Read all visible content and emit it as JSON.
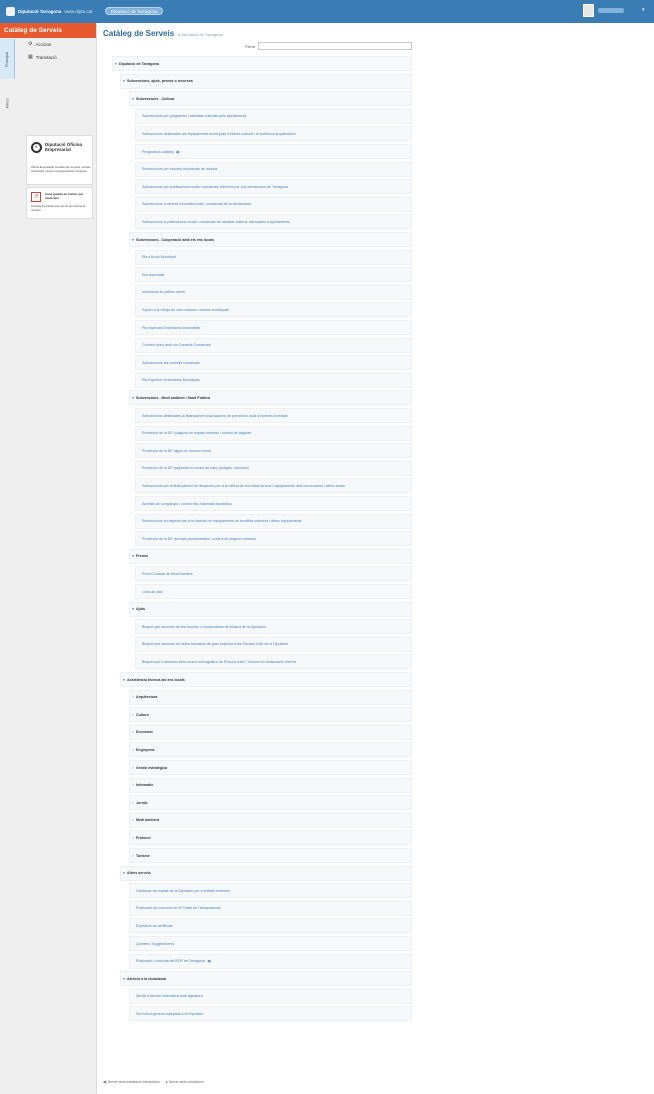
{
  "topbar": {
    "brand": "Diputació Tarragona",
    "brand_url": "www.dipta.cat",
    "pill": "Diputació de Tarragona",
    "user_caret": "▾"
  },
  "sidebar": {
    "title": "Catàleg de Serveis",
    "tabs": [
      "Principal",
      "Altres"
    ],
    "items": [
      {
        "icon": "⚙",
        "label": "Accions"
      },
      {
        "icon": "▦",
        "label": "Tramitació"
      }
    ],
    "ad1": {
      "name": "Diputació Oficina Empresarial",
      "desc": "Oficina Empresarial: Accedeix als recursos i serveis d'orientació i suport a l'emprenedoria i l'empresa"
    },
    "ad2": {
      "name": "Zona guiada de tràmits per municipis",
      "desc": "Consulta els tràmits que pots fer per Internet al municipi"
    }
  },
  "main": {
    "title": "Catàleg de Serveis",
    "subtitle": "a Diputació de Tarragona",
    "filter_label": "Filtrar",
    "filter_value": "",
    "rows": [
      {
        "level": 0,
        "kind": "cat",
        "arrow": "▾",
        "label": "Diputació de Tarragona"
      },
      {
        "level": 1,
        "kind": "cat",
        "arrow": "▾",
        "label": "Subvencions, ajuts, premis o recursos"
      },
      {
        "level": 2,
        "kind": "cat",
        "arrow": "▾",
        "label": "Subvencions - Cultura"
      },
      {
        "level": 3,
        "kind": "leaf",
        "label": "Subvencions per programes i activitats culturals pels ajuntaments"
      },
      {
        "level": 3,
        "kind": "leaf",
        "label": "Subvencions destinades als equipaments municipals d'interès cultural i al patrimoni arquitectònic"
      },
      {
        "level": 3,
        "kind": "leaf",
        "label": "Programa e-catàleg",
        "badge": "◀)"
      },
      {
        "level": 3,
        "kind": "leaf",
        "label": "Subvencions per escoles municipals de música"
      },
      {
        "level": 3,
        "kind": "leaf",
        "label": "Subvencions per publicacions locals i comarcals d'interès per a la demarcació de Tarragona"
      },
      {
        "level": 3,
        "kind": "leaf",
        "label": "Subvencions a centres d'estudis locals i comarcals de la demarcació"
      },
      {
        "level": 3,
        "kind": "leaf",
        "label": "Subvencions a publicacions locals i comarcals de caràcter cultural, adreçades a ajuntaments"
      },
      {
        "level": 2,
        "kind": "cat",
        "arrow": "▾",
        "label": "Subvencions - Cooperació amb els ens locals"
      },
      {
        "level": 3,
        "kind": "leaf",
        "label": "Pla d'Acció Municipal"
      },
      {
        "level": 3,
        "kind": "leaf",
        "label": "Ens Associats"
      },
      {
        "level": 3,
        "kind": "leaf",
        "label": "Inversions de petites obres"
      },
      {
        "level": 3,
        "kind": "leaf",
        "label": "Suport a la neteja de vies urbanes i camins municipals"
      },
      {
        "level": 3,
        "kind": "leaf",
        "label": "Pla especial d'inversions sostenibles"
      },
      {
        "level": 3,
        "kind": "leaf",
        "label": "Conveni marc amb els Consells Comarcals"
      },
      {
        "level": 3,
        "kind": "leaf",
        "label": "Subvencions als consells comarcals"
      },
      {
        "level": 3,
        "kind": "leaf",
        "label": "Pla Especial d'Inversions Municipals"
      },
      {
        "level": 2,
        "kind": "cat",
        "arrow": "▾",
        "label": "Subvencions - Medi ambient i Salut Pública"
      },
      {
        "level": 3,
        "kind": "leaf",
        "label": "Subvencions destinades al finançament d'actuacions de prevenció local d'incendis forestals"
      },
      {
        "level": 3,
        "kind": "leaf",
        "label": "Prevenció de la DP i plagues en espais forestals i control de plagues"
      },
      {
        "level": 3,
        "kind": "leaf",
        "label": "Prevenció de la DP aigua de consum humà"
      },
      {
        "level": 3,
        "kind": "leaf",
        "label": "Prevenció de la DP seguretat en zones de bany (platges i piscines)"
      },
      {
        "level": 3,
        "kind": "leaf",
        "label": "Subvencions per al finançament de despeses per a la millora de les instal·lacions i equipaments dels escorxadors i altres locals"
      },
      {
        "level": 3,
        "kind": "leaf",
        "label": "Animals de companyia i control ètic d'animals domèstics"
      },
      {
        "level": 3,
        "kind": "leaf",
        "label": "Subvencions en espècie per a la inversió en equipaments de recollida selectiva i altres equipaments"
      },
      {
        "level": 3,
        "kind": "leaf",
        "label": "Prevenció de la DP, animals peridomèstics i control de plagues urbanes"
      },
      {
        "level": 2,
        "kind": "cat",
        "arrow": "▾",
        "label": "Premis"
      },
      {
        "level": 3,
        "kind": "leaf",
        "label": "Premi Ciutadà de Medi Ambient"
      },
      {
        "level": 3,
        "kind": "leaf",
        "label": "Línia de vida"
      },
      {
        "level": 2,
        "kind": "cat",
        "arrow": "▾",
        "label": "Ajuts"
      },
      {
        "level": 3,
        "kind": "leaf",
        "label": "Beques per alumnes de les escoles i Conservatoris de Música de la Diputació"
      },
      {
        "level": 3,
        "kind": "leaf",
        "label": "Beques per alumnes de cicles formatius de grau superior a les Escoles d'Art de la Diputació"
      },
      {
        "level": 3,
        "kind": "leaf",
        "label": "Beques per a alumnes dels cursos monogràfics de l'Escola d'Art i Turisme en restauració d'obres"
      },
      {
        "level": 1,
        "kind": "cat",
        "arrow": "▾",
        "label": "Assistència tècnica als ens locals"
      },
      {
        "level": 2,
        "kind": "cat",
        "arrow": "›",
        "label": "Arquitectura"
      },
      {
        "level": 2,
        "kind": "cat",
        "arrow": "›",
        "label": "Cultura"
      },
      {
        "level": 2,
        "kind": "cat",
        "arrow": "›",
        "label": "Econòmic"
      },
      {
        "level": 2,
        "kind": "cat",
        "arrow": "›",
        "label": "Enginyeria"
      },
      {
        "level": 2,
        "kind": "cat",
        "arrow": "›",
        "label": "Gestió estratègica"
      },
      {
        "level": 2,
        "kind": "cat",
        "arrow": "›",
        "label": "Informàtic"
      },
      {
        "level": 2,
        "kind": "cat",
        "arrow": "›",
        "label": "Jurídic"
      },
      {
        "level": 2,
        "kind": "cat",
        "arrow": "›",
        "label": "Medi ambient"
      },
      {
        "level": 2,
        "kind": "cat",
        "arrow": "›",
        "label": "Protocol"
      },
      {
        "level": 2,
        "kind": "cat",
        "arrow": "›",
        "label": "Turisme"
      },
      {
        "level": 1,
        "kind": "cat",
        "arrow": "▾",
        "label": "Altres serveis"
      },
      {
        "level": 2,
        "kind": "leaf",
        "label": "Gestionar els espais de la Diputació per a entitats externes"
      },
      {
        "level": 2,
        "kind": "leaf",
        "label": "Publicació de convenis en el Portal de Transparència"
      },
      {
        "level": 2,
        "kind": "leaf",
        "label": "Expedició de certificats"
      },
      {
        "level": 2,
        "kind": "leaf",
        "label": "Queixes i Suggeriments"
      },
      {
        "level": 2,
        "kind": "leaf",
        "label": "Publicació i consulta del BOP de Tarragona",
        "badge": "◀)"
      },
      {
        "level": 1,
        "kind": "cat",
        "arrow": "▾",
        "label": "Atenció a la ciutadania"
      },
      {
        "level": 2,
        "kind": "leaf",
        "label": "Servei d'atenció telemàtica amb signatura"
      },
      {
        "level": 2,
        "kind": "leaf",
        "label": "Sol·licitud general adreçada a la Diputació"
      }
    ],
    "legend": [
      {
        "icon": "◀)",
        "label": "Servei amb tramitació electrònica"
      },
      {
        "icon": "●",
        "label": "Servei amb condicions"
      }
    ]
  },
  "colors": {
    "topbar": "#3a7cb4",
    "sidebar_title": "#e75a2f",
    "link": "#4b7fb5",
    "row_bg": "#f6f9fc"
  }
}
